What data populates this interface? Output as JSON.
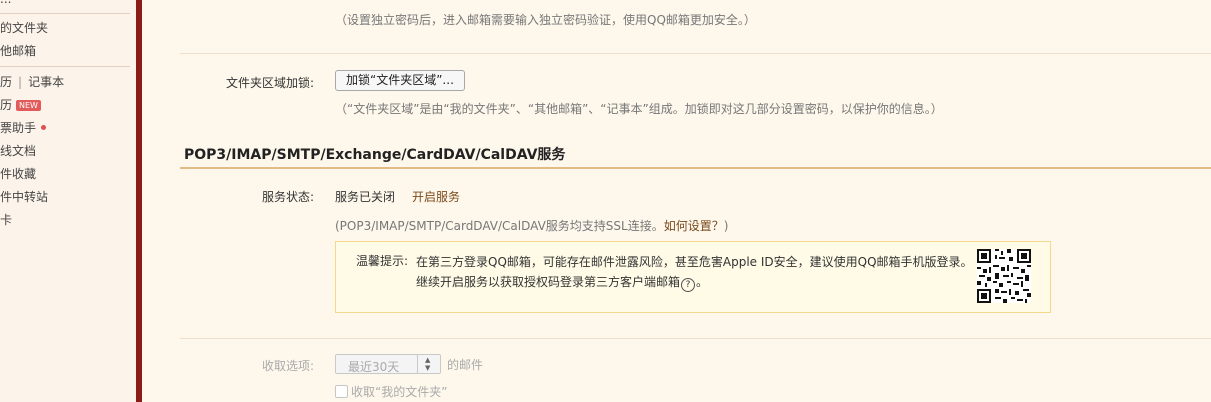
{
  "sidebar": {
    "partial_top": "...",
    "folders_label": "的文件夹",
    "other_mail_label": "他邮箱",
    "calendar_label": "历",
    "notes_label": "记事本",
    "calendar2_label": "历",
    "new_badge": "NEW",
    "ticket_helper_label": "票助手",
    "online_docs_label": "线文档",
    "favorites_label": "件收藏",
    "transfer_label": "件中转站",
    "card_label": "卡"
  },
  "main": {
    "top_hint": "（设置独立密码后，进入邮箱需要输入独立密码验证，使用QQ邮箱更加安全。）",
    "folder_lock_label": "文件夹区域加锁:",
    "folder_lock_button": "加锁“文件夹区域”...",
    "folder_lock_hint": "（“文件夹区域”是由“我的文件夹”、“其他邮箱”、“记事本”组成。加锁即对这几部分设置密码，以保护你的信息。）",
    "service_section_title": "POP3/IMAP/SMTP/Exchange/CardDAV/CalDAV服务",
    "service_status_label": "服务状态:",
    "service_status_value": "服务已关闭",
    "enable_service_link": "开启服务",
    "ssl_note_prefix": "(POP3/IMAP/SMTP/CardDAV/CalDAV服务均支持SSL连接。",
    "ssl_note_link": "如何设置？",
    "ssl_note_suffix": ")",
    "tip_label": "温馨提示:",
    "tip_line1": "在第三方登录QQ邮箱，可能存在邮件泄露风险，甚至危害Apple ID安全，建议使用QQ邮箱手机版登录。",
    "tip_line2": "继续开启服务以获取授权码登录第三方客户端邮箱",
    "tip_help_glyph": "?",
    "tip_line2_end": "。",
    "fetch_label": "收取选项:",
    "fetch_select_value": "最近30天",
    "fetch_suffix": "的邮件",
    "fetch_checkbox_label": "收取“我的文件夹”"
  },
  "colors": {
    "accent_bar": "#8c1c17",
    "section_line": "#e4bb84",
    "tip_border": "#f2d98c",
    "link": "#7a4a1c",
    "page_bg": "#fef8ec"
  }
}
